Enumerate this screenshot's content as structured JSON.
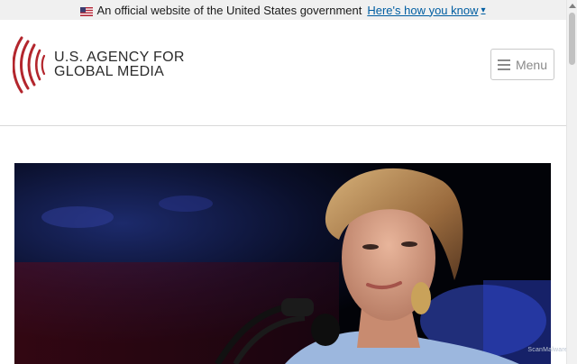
{
  "gov_banner": {
    "text": "An official website of the United States government",
    "link_label": "Here's how you know",
    "chevron": "▾"
  },
  "header": {
    "logo_line1": "U.S. AGENCY FOR",
    "logo_line2": "GLOBAL MEDIA",
    "menu_label": "Menu"
  },
  "hero": {
    "image_subject": "woman speaking at microphone on stage"
  },
  "watermark": {
    "text": "ScanMalware"
  },
  "colors": {
    "link": "#005ea2",
    "logo_red": "#b3262d",
    "banner_bg": "#f0f0f0"
  }
}
